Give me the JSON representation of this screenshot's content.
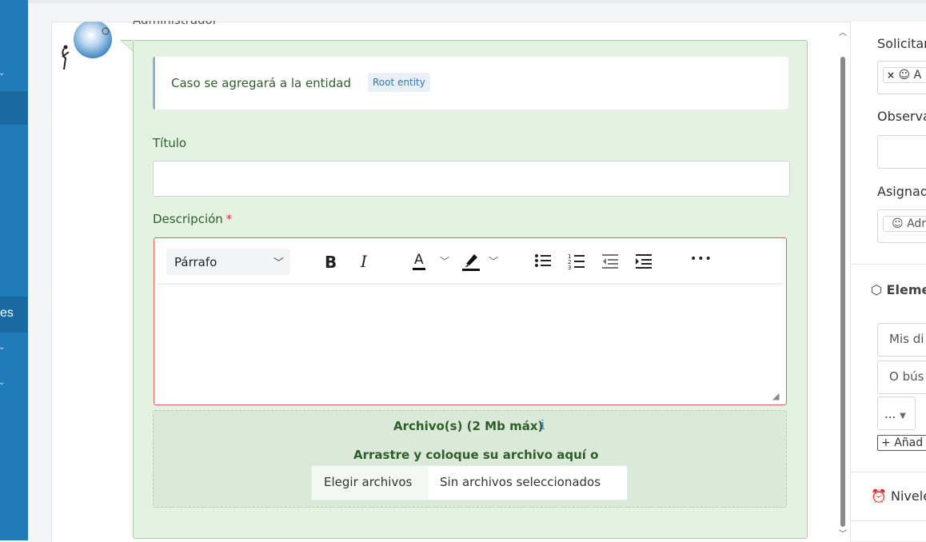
{
  "admin_name": "Administrador",
  "info": {
    "text": "Caso se agregará a la entidad",
    "badge": "Root entity"
  },
  "titulo_label": "Título",
  "descripcion_label": "Descripción",
  "required_mark": "*",
  "editor": {
    "paragraph_select": "Párrafo",
    "tools": {
      "bold": "B",
      "italic": "I",
      "font_color": "A",
      "bullets": "bulleted-list",
      "numbers": "numbered-list",
      "outdent": "outdent",
      "indent": "indent",
      "more": "•••"
    }
  },
  "upload": {
    "title": "Archivo(s) (2 Mb máx)",
    "info_icon": "i",
    "drop_text": "Arrastre y coloque su archivo aquí o",
    "choose_button": "Elegir archivos",
    "no_files": "Sin archivos seleccionados"
  },
  "sidebar": {
    "visible_label": "es"
  },
  "right_panel": {
    "solicitante_label": "Solicitan",
    "solicitante_value": "A",
    "observa_label": "Observa",
    "asignado_label": "Asignad",
    "asignado_value": "Adr",
    "elementos_label": "Eleme",
    "mis_label": "Mis di",
    "busqueda_label": "O bús",
    "dots": "...",
    "add_label": "Añad",
    "niveles_label": "Nivele"
  },
  "colors": {
    "sidebar": "#1f7cb8",
    "comment_bg": "#e3f2e1",
    "green_text": "#2e5f2a",
    "required": "#e03131",
    "editor_border": "#e0605a"
  }
}
